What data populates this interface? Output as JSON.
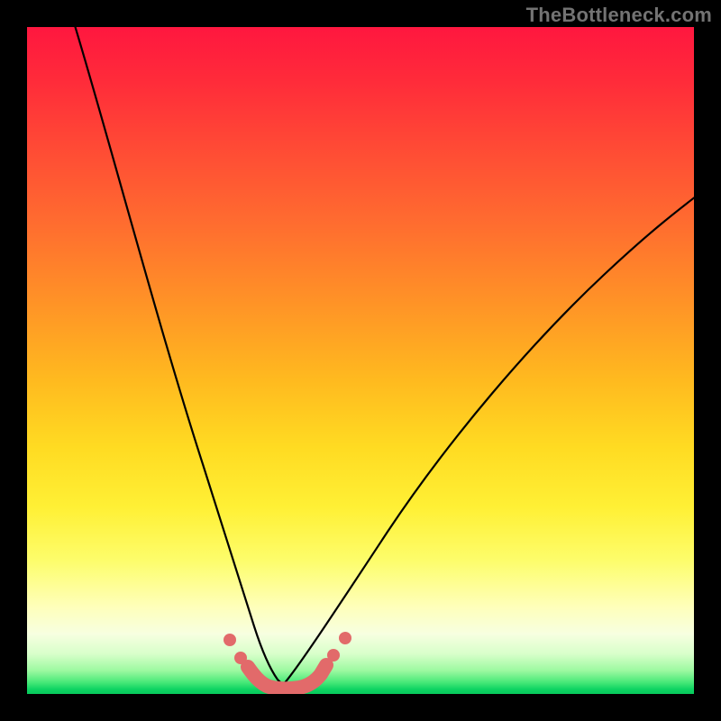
{
  "watermark": "TheBottleneck.com",
  "chart_data": {
    "type": "line",
    "title": "",
    "xlabel": "",
    "ylabel": "",
    "xlim": [
      0,
      100
    ],
    "ylim": [
      0,
      100
    ],
    "grid": false,
    "legend": false,
    "series": [
      {
        "name": "bottleneck-curve",
        "color": "#000000",
        "x": [
          7,
          10,
          14,
          18,
          22,
          25,
          27,
          29,
          31,
          33,
          35,
          36,
          38,
          43,
          46,
          50,
          55,
          61,
          68,
          76,
          84,
          92,
          100
        ],
        "y": [
          100,
          85,
          68,
          52,
          37,
          25,
          16,
          9,
          5,
          2.5,
          1.2,
          0.8,
          1.2,
          3,
          6,
          11,
          18,
          27,
          37,
          47,
          56,
          64,
          71
        ]
      }
    ],
    "markers": {
      "name": "optimal-zone",
      "color": "#e26a6a",
      "thick_segment": {
        "x": [
          33,
          43
        ],
        "y": [
          2.5,
          3
        ]
      },
      "dots": [
        {
          "x": 29.5,
          "y": 8
        },
        {
          "x": 31.5,
          "y": 4.5
        },
        {
          "x": 45.5,
          "y": 5.5
        },
        {
          "x": 47.5,
          "y": 8.5
        }
      ]
    },
    "gradient_stops": [
      {
        "pos": 0,
        "color": "#ff173f"
      },
      {
        "pos": 50,
        "color": "#ffba1f"
      },
      {
        "pos": 80,
        "color": "#fdfd6b"
      },
      {
        "pos": 100,
        "color": "#07c95c"
      }
    ]
  }
}
